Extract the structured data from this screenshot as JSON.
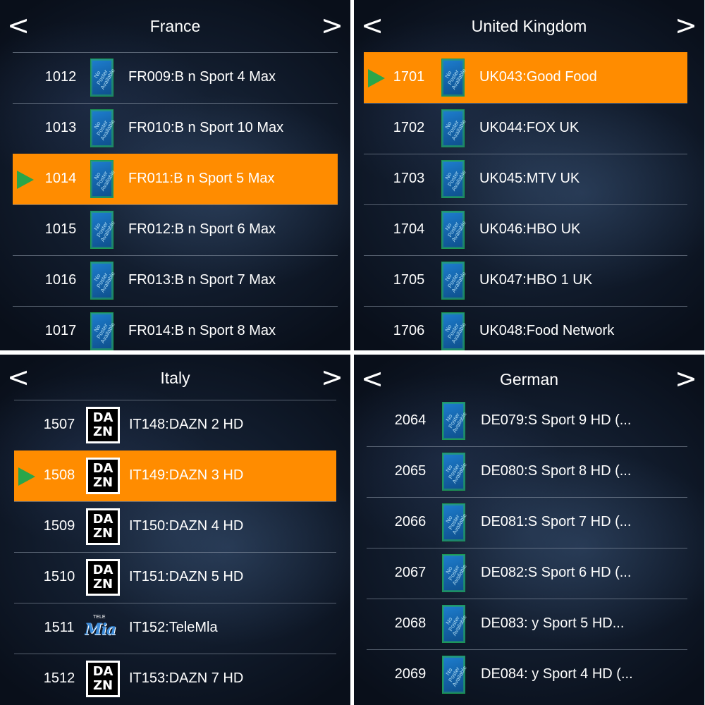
{
  "nav": {
    "prev": "<",
    "next": ">"
  },
  "panels": {
    "fr": {
      "title": "France",
      "rows": [
        {
          "num": "1012",
          "name": "FR009:B   n Sport 4 Max"
        },
        {
          "num": "1013",
          "name": "FR010:B   n Sport 10 Max"
        },
        {
          "num": "1014",
          "name": "FR011:B   n Sport 5 Max"
        },
        {
          "num": "1015",
          "name": "FR012:B   n Sport 6 Max"
        },
        {
          "num": "1016",
          "name": "FR013:B   n Sport 7 Max"
        },
        {
          "num": "1017",
          "name": "FR014:B   n Sport 8 Max"
        }
      ],
      "selected": "1014"
    },
    "uk": {
      "title": "United Kingdom",
      "rows": [
        {
          "num": "1701",
          "name": "UK043:Good Food"
        },
        {
          "num": "1702",
          "name": "UK044:FOX UK"
        },
        {
          "num": "1703",
          "name": "UK045:MTV UK"
        },
        {
          "num": "1704",
          "name": "UK046:HBO UK"
        },
        {
          "num": "1705",
          "name": "UK047:HBO 1 UK"
        },
        {
          "num": "1706",
          "name": "UK048:Food Network"
        }
      ],
      "selected": "1701"
    },
    "it": {
      "title": "Italy",
      "rows": [
        {
          "num": "1507",
          "name": "IT148:DAZN 2 HD",
          "logo": "dazn"
        },
        {
          "num": "1508",
          "name": "IT149:DAZN 3 HD",
          "logo": "dazn"
        },
        {
          "num": "1509",
          "name": "IT150:DAZN 4 HD",
          "logo": "dazn"
        },
        {
          "num": "1510",
          "name": "IT151:DAZN 5 HD",
          "logo": "dazn"
        },
        {
          "num": "1511",
          "name": "IT152:TeleMla",
          "logo": "telemia"
        },
        {
          "num": "1512",
          "name": "IT153:DAZN 7 HD",
          "logo": "dazn"
        }
      ],
      "selected": "1508"
    },
    "de": {
      "title": "German",
      "rows": [
        {
          "num": "2064",
          "name": "DE079:S      Sport 9 HD (..."
        },
        {
          "num": "2065",
          "name": "DE080:S      Sport 8 HD (..."
        },
        {
          "num": "2066",
          "name": "DE081:S      Sport 7 HD (..."
        },
        {
          "num": "2067",
          "name": "DE082:S      Sport 6 HD (..."
        },
        {
          "num": "2068",
          "name": "DE083:     y Sport 5 HD..."
        },
        {
          "num": "2069",
          "name": "DE084:     y Sport 4 HD (..."
        }
      ]
    }
  },
  "logos": {
    "poster_text": "No Poster Available",
    "dazn_text": "DA ZN",
    "telemia_top": "TELE",
    "telemia_main": "Mia"
  },
  "colors": {
    "selected_row": "#ff8c00",
    "play_indicator": "#2aa64a",
    "background": "#101a2a"
  },
  "icons": {
    "prev": "chevron-left-icon",
    "next": "chevron-right-icon",
    "play": "play-indicator-icon"
  }
}
